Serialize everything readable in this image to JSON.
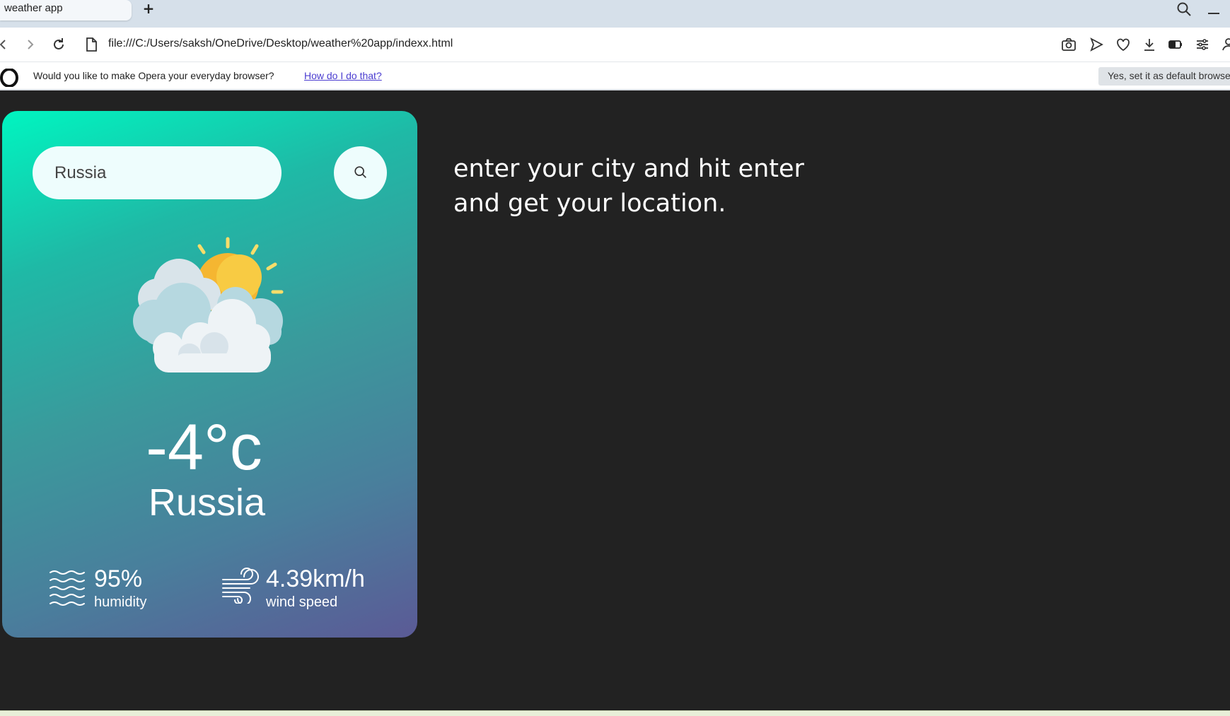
{
  "browser": {
    "tab_title": "weather app",
    "new_tab_symbol": "+",
    "url": "file:///C:/Users/saksh/OneDrive/Desktop/weather%20app/indexx.html",
    "infobar": {
      "message": "Would you like to make Opera your everyday browser?",
      "link": "How do I do that?",
      "default_button": "Yes, set it as default browser"
    },
    "toolbar_icons": [
      "back-icon",
      "forward-icon",
      "reload-icon",
      "page-info-icon",
      "camera-icon",
      "send-icon",
      "heart-icon",
      "download-icon",
      "battery-saver-icon",
      "easy-setup-icon",
      "profile-icon"
    ]
  },
  "weather": {
    "search": {
      "value": "Russia",
      "placeholder": ""
    },
    "condition_icon": "sun-behind-clouds-icon",
    "temperature": "-4°c",
    "city": "Russia",
    "humidity": {
      "value": "95%",
      "label": "humidity",
      "icon": "humidity-waves-icon"
    },
    "wind": {
      "value": "4.39km/h",
      "label": "wind speed",
      "icon": "wind-icon"
    },
    "colors": {
      "gradient_start": "#00f5c0",
      "gradient_end": "#5b5a96",
      "page_background": "#222222"
    }
  },
  "hint": {
    "text": "enter your city and hit enter and get your location."
  }
}
